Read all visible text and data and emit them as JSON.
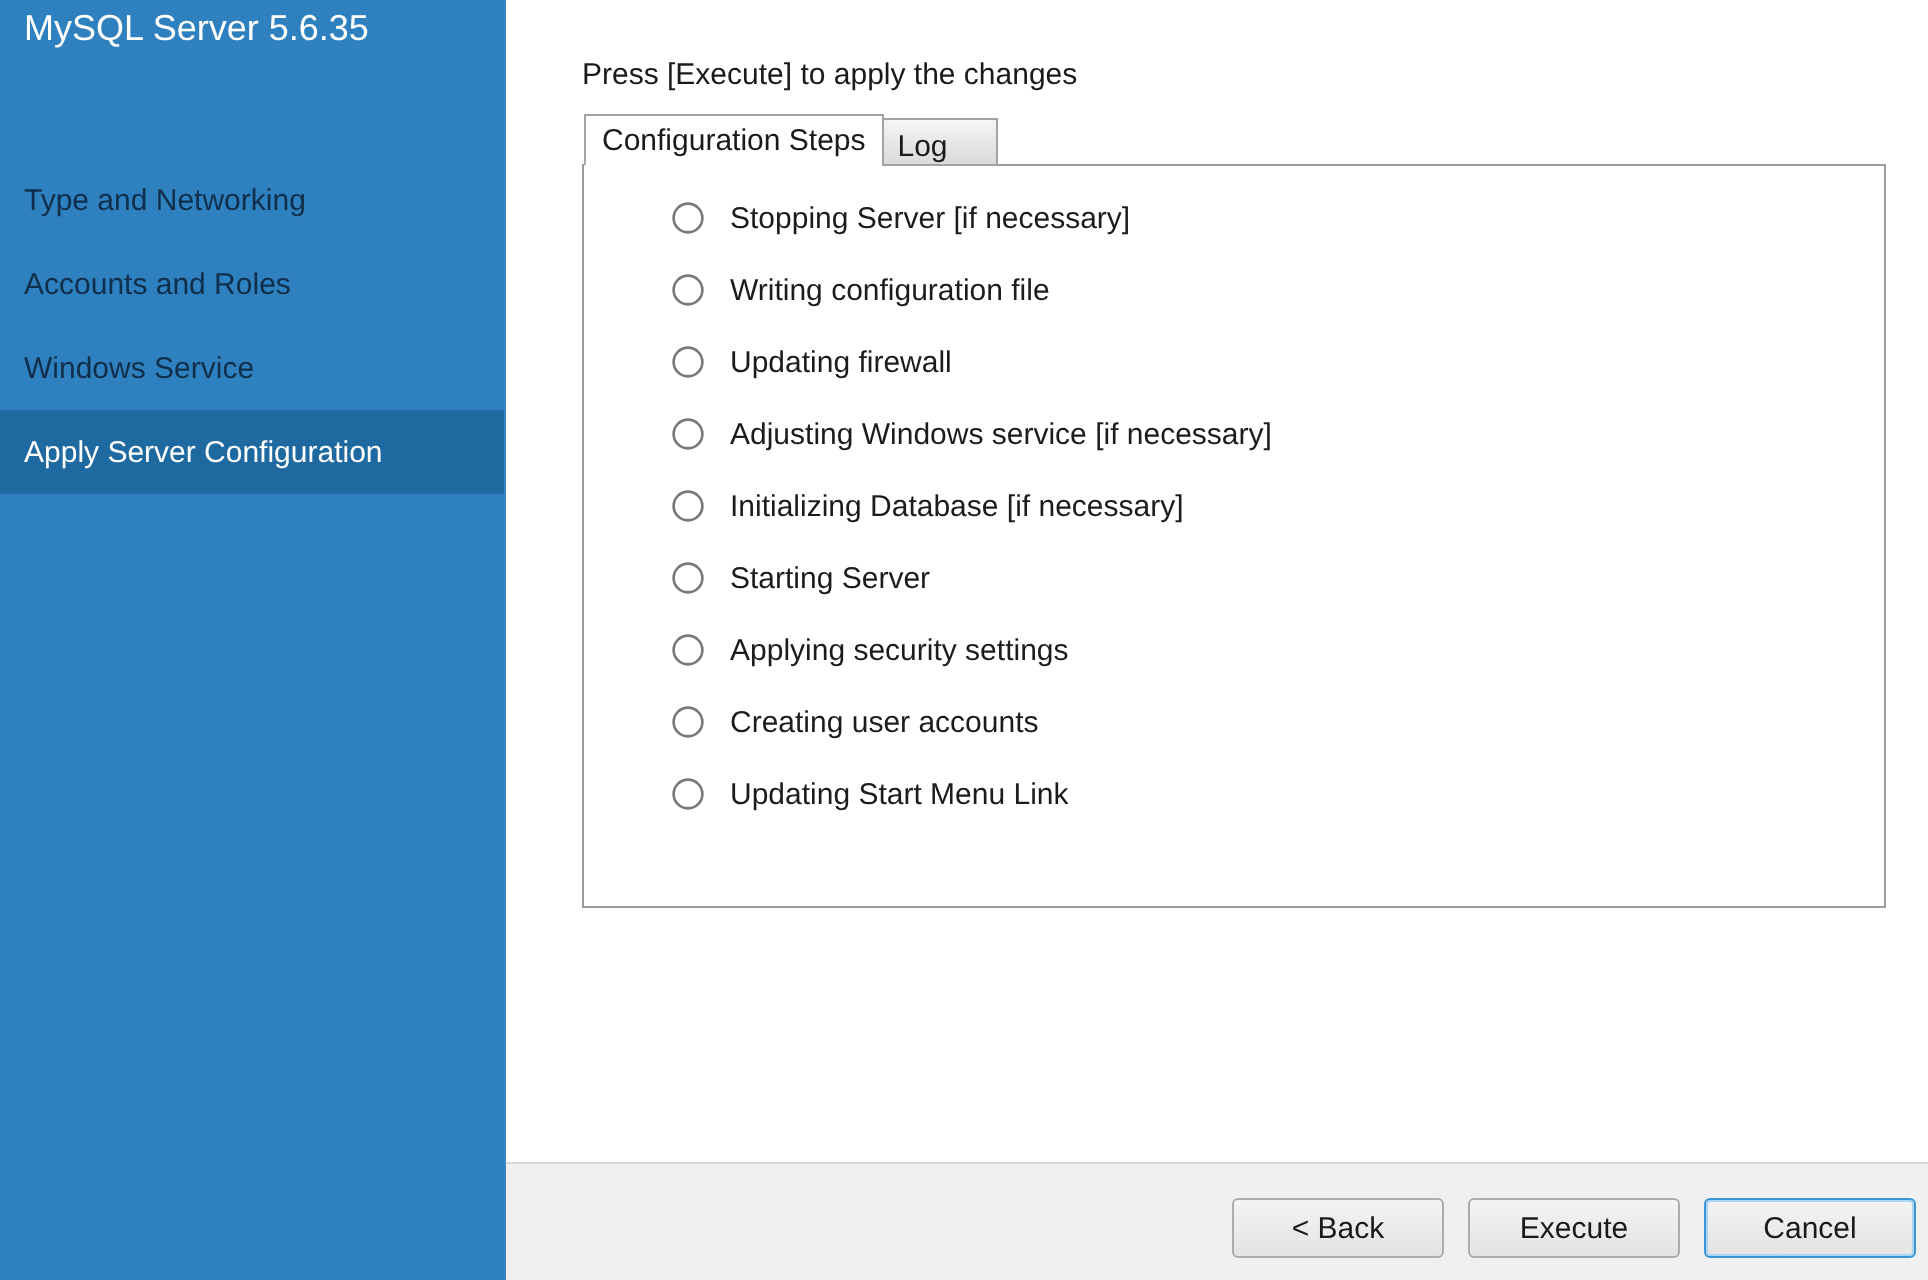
{
  "sidebar": {
    "title": "MySQL Server 5.6.35",
    "items": [
      {
        "label": "Type and Networking",
        "selected": false
      },
      {
        "label": "Accounts and Roles",
        "selected": false
      },
      {
        "label": "Windows Service",
        "selected": false
      },
      {
        "label": "Apply Server Configuration",
        "selected": true
      }
    ]
  },
  "main": {
    "instruction": "Press [Execute] to apply the changes",
    "tabs": [
      {
        "label": "Configuration Steps",
        "selected": true
      },
      {
        "label": "Log",
        "selected": false
      }
    ],
    "steps": [
      {
        "label": "Stopping Server [if necessary]",
        "done": false
      },
      {
        "label": "Writing configuration file",
        "done": false
      },
      {
        "label": "Updating firewall",
        "done": false
      },
      {
        "label": "Adjusting Windows service [if necessary]",
        "done": false
      },
      {
        "label": "Initializing Database [if necessary]",
        "done": false
      },
      {
        "label": "Starting Server",
        "done": false
      },
      {
        "label": "Applying security settings",
        "done": false
      },
      {
        "label": "Creating user accounts",
        "done": false
      },
      {
        "label": "Updating Start Menu Link",
        "done": false
      }
    ]
  },
  "buttons": [
    {
      "label": "< Back",
      "focused": false
    },
    {
      "label": "Execute",
      "focused": false
    },
    {
      "label": "Cancel",
      "focused": true
    }
  ]
}
